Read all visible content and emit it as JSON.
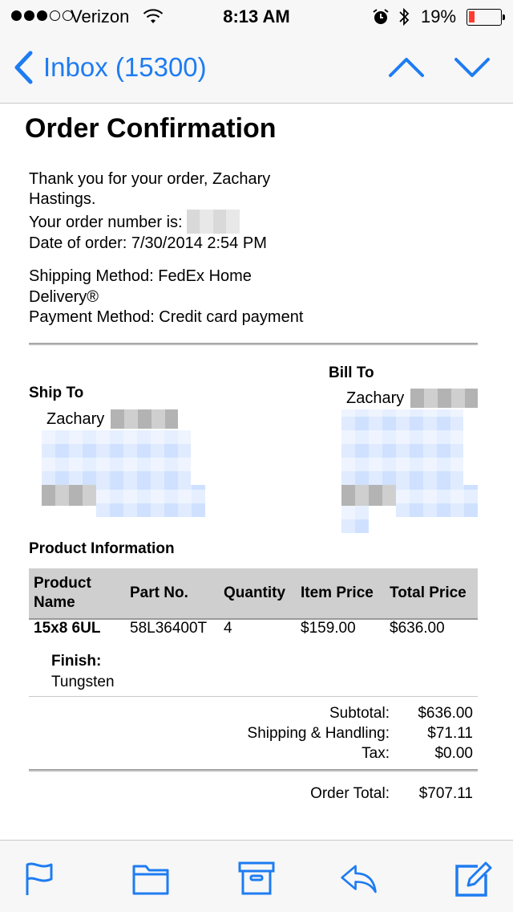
{
  "status_bar": {
    "carrier": "Verizon",
    "time": "8:13 AM",
    "battery_percent": "19%",
    "signal_bars_filled": 3,
    "signal_bars_total": 5,
    "battery_level": 0.19,
    "battery_color": "#ff3b30"
  },
  "nav": {
    "back_label": "Inbox (15300)",
    "accent_color": "#1e7cf2",
    "up_icon": "chevron-up-icon",
    "down_icon": "chevron-down-icon"
  },
  "email": {
    "title": "Order Confirmation",
    "thank_you_line": "Thank you for your order, Zachary Hastings.",
    "order_number_label": "Your order number is:",
    "order_date_line": "Date of order: 7/30/2014 2:54 PM",
    "shipping_method_line": "Shipping Method: FedEx Home Delivery®",
    "payment_method_line": "Payment Method: Credit card payment",
    "ship_to": {
      "heading": "Ship To",
      "name": "Zachary"
    },
    "bill_to": {
      "heading": "Bill To",
      "name": "Zachary"
    },
    "product_heading": "Product Information",
    "table": {
      "headers": [
        "Product Name",
        "Part No.",
        "Quantity",
        "Item Price",
        "Total Price"
      ],
      "rows": [
        {
          "product_name": "15x8 6UL",
          "part_no": "58L36400T",
          "quantity": "4",
          "item_price": "$159.00",
          "total_price": "$636.00"
        }
      ],
      "finish_label": "Finish:",
      "finish_value": "Tungsten"
    },
    "totals": {
      "subtotal_label": "Subtotal:",
      "subtotal_value": "$636.00",
      "shipping_label": "Shipping & Handling:",
      "shipping_value": "$71.11",
      "tax_label": "Tax:",
      "tax_value": "$0.00",
      "order_total_label": "Order Total:",
      "order_total_value": "$707.11"
    }
  },
  "toolbar": {
    "icons": [
      "flag-icon",
      "folder-icon",
      "archive-icon",
      "reply-icon",
      "compose-icon"
    ]
  }
}
